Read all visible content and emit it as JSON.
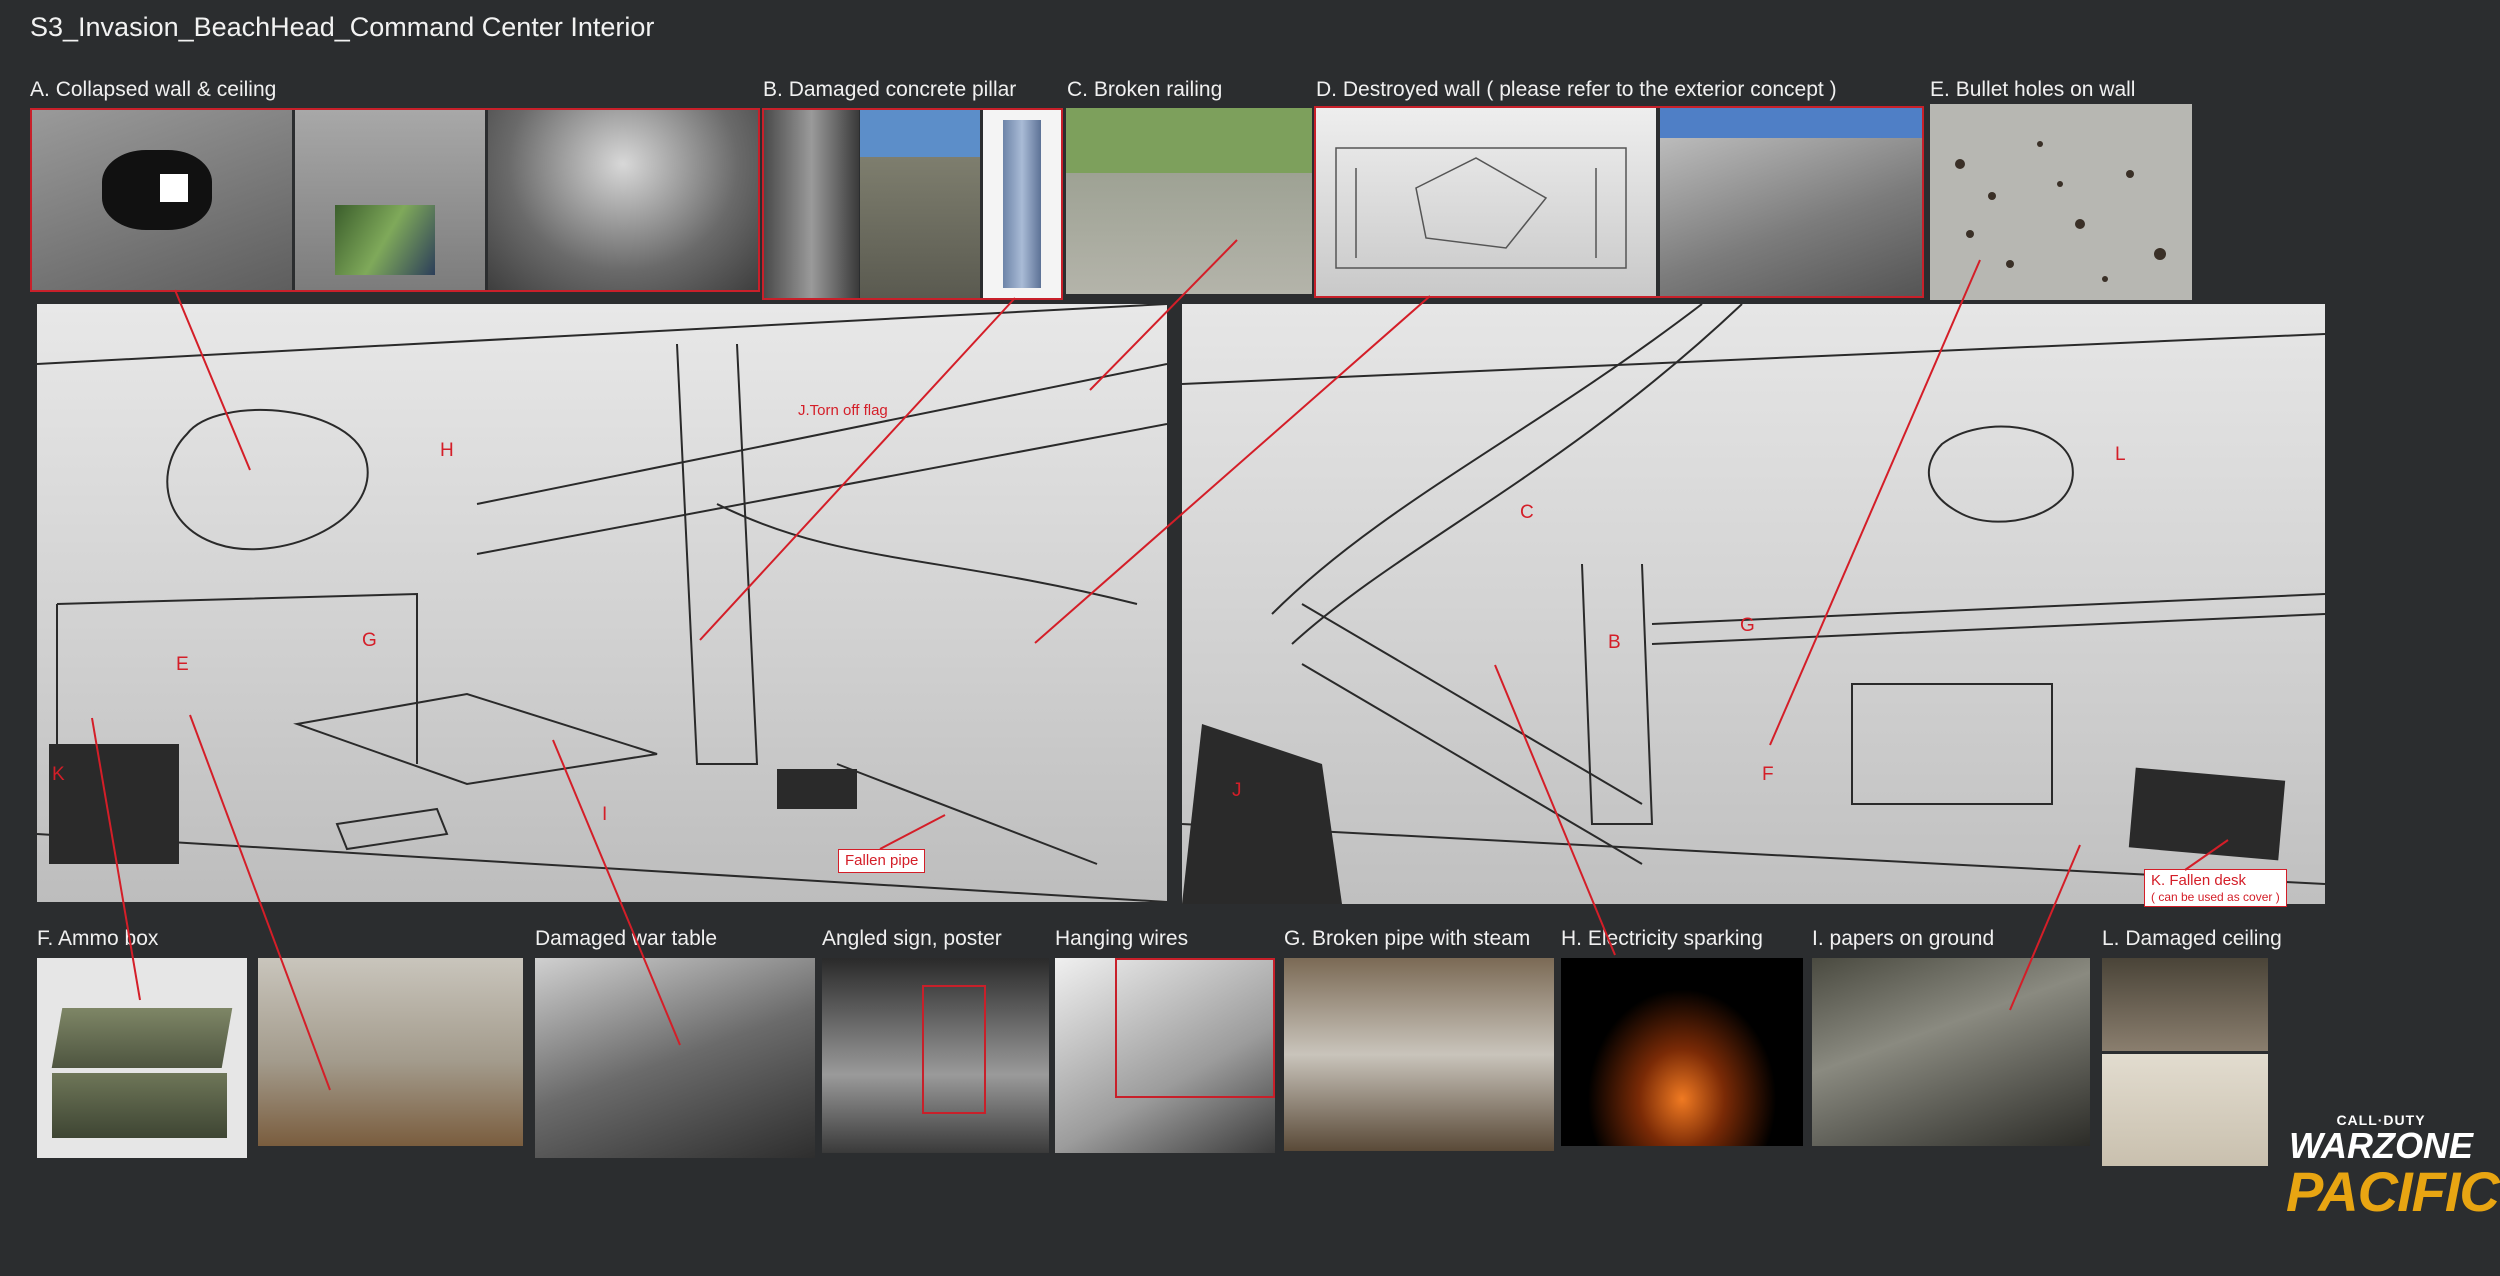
{
  "title": "S3_Invasion_BeachHead_Command Center Interior",
  "top_refs": [
    {
      "letter": "A.",
      "label": "Collapsed wall & ceiling"
    },
    {
      "letter": "B.",
      "label": "Damaged concrete pillar"
    },
    {
      "letter": "C.",
      "label": "Broken railing"
    },
    {
      "letter": "D.",
      "label": "Destroyed wall ( please refer to the exterior concept )"
    },
    {
      "letter": "E.",
      "label": "Bullet holes on wall"
    }
  ],
  "bottom_refs": [
    {
      "letter": "F.",
      "label": "Ammo box"
    },
    {
      "letter": "",
      "label": "Damaged war table"
    },
    {
      "letter": "",
      "label": "Angled sign, poster"
    },
    {
      "letter": "",
      "label": "Hanging wires"
    },
    {
      "letter": "G.",
      "label": "Broken pipe with steam"
    },
    {
      "letter": "H.",
      "label": "Electricity sparking"
    },
    {
      "letter": "I.",
      "label": "papers on ground"
    },
    {
      "letter": "L.",
      "label": "Damaged ceiling"
    }
  ],
  "left_sketch_callouts": {
    "flag": "J.Torn off flag",
    "h": "H",
    "e": "E",
    "g": "G",
    "k": "K",
    "i": "I",
    "pipe": "Fallen pipe"
  },
  "right_sketch_callouts": {
    "c": "C",
    "l": "L",
    "b": "B",
    "g": "G",
    "j": "J",
    "f": "F",
    "desk_line1": "K. Fallen desk",
    "desk_line2": "( can be used as cover )"
  },
  "logo": {
    "line1": "CALL·DUTY",
    "line2": "WARZONE",
    "line3": "PACIFIC"
  },
  "colors": {
    "background": "#2b2d2f",
    "annotation_red": "#d41e28",
    "logo_gold": "#e8a512"
  }
}
